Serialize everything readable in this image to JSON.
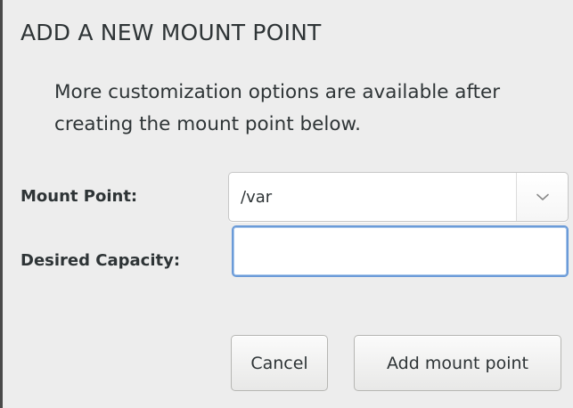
{
  "dialog": {
    "title": "ADD A NEW MOUNT POINT",
    "description": "More customization options are available after creating the mount point below."
  },
  "form": {
    "mount_point": {
      "label": "Mount Point:",
      "value": "/var",
      "dropdown_icon": "chevron-down-icon"
    },
    "desired_capacity": {
      "label": "Desired Capacity:",
      "value": ""
    }
  },
  "buttons": {
    "cancel_label": "Cancel",
    "add_label": "Add mount point"
  },
  "colors": {
    "background": "#ededed",
    "text": "#2e3436",
    "focus_border": "#6b9bd8"
  }
}
